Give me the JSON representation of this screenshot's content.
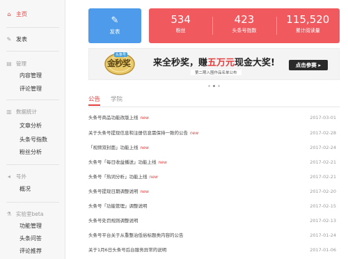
{
  "sidebar": {
    "home": "主页",
    "publish": "发表",
    "sections": [
      {
        "title": "管理",
        "items": [
          "内容管理",
          "评论管理"
        ]
      },
      {
        "title": "数据统计",
        "items": [
          "文章分析",
          "头条号指数",
          "粉丝分析"
        ]
      },
      {
        "title": "号外",
        "items": [
          "概况"
        ]
      },
      {
        "title": "实验室beta",
        "items": [
          "功能管理",
          "头条问答",
          "评论推荐"
        ]
      }
    ]
  },
  "post_button": {
    "label": "发表"
  },
  "stats": [
    {
      "value": "534",
      "label": "粉丝"
    },
    {
      "value": "423",
      "label": "头条号指数"
    },
    {
      "value": "115,520",
      "label": "累计阅读量"
    }
  ],
  "banner": {
    "medal_text": "金秒奖",
    "medal_tag": "头条号",
    "headline_pre": "来全秒奖，赚",
    "headline_highlight": "五万元",
    "headline_post": "现金大奖!",
    "subline": "第二期入围作品名单公布",
    "cta": "点击参赛"
  },
  "tabs": [
    "公告",
    "学院"
  ],
  "notices": [
    {
      "title": "头条号商品功能改版上线",
      "new": "new",
      "date": "2017-03-01"
    },
    {
      "title": "关于头条号提现信息和注册信息需保持一致的公告",
      "new": "new",
      "date": "2017-02-28"
    },
    {
      "title": "「视频双封面」功能上线",
      "new": "new",
      "date": "2017-02-24"
    },
    {
      "title": "头条号「每日收益播送」功能上线",
      "new": "new",
      "date": "2017-02-21"
    },
    {
      "title": "头条号「热词分析」功能上线",
      "new": "new",
      "date": "2017-02-21"
    },
    {
      "title": "头条号提现日期调整说明",
      "new": "new",
      "date": "2017-02-20"
    },
    {
      "title": "头条号「功能管理」调整说明",
      "new": "",
      "date": "2017-02-15"
    },
    {
      "title": "头条号处罚规则调整说明",
      "new": "",
      "date": "2017-02-13"
    },
    {
      "title": "头条号平台关于从重整治低俗标题类内容的公告",
      "new": "",
      "date": "2017-01-24"
    },
    {
      "title": "关于1月6日头条号后台服务异常的说明",
      "new": "",
      "date": "2017-01-06"
    }
  ],
  "colors": {
    "accent": "#e63d3d",
    "stats_bg": "#f05a5f",
    "post_bg": "#4d9bea"
  },
  "icons": {
    "home": "home-icon",
    "publish": "edit-icon",
    "manage": "doc-icon",
    "data": "chart-icon",
    "extra": "megaphone-icon",
    "lab": "flask-icon"
  }
}
